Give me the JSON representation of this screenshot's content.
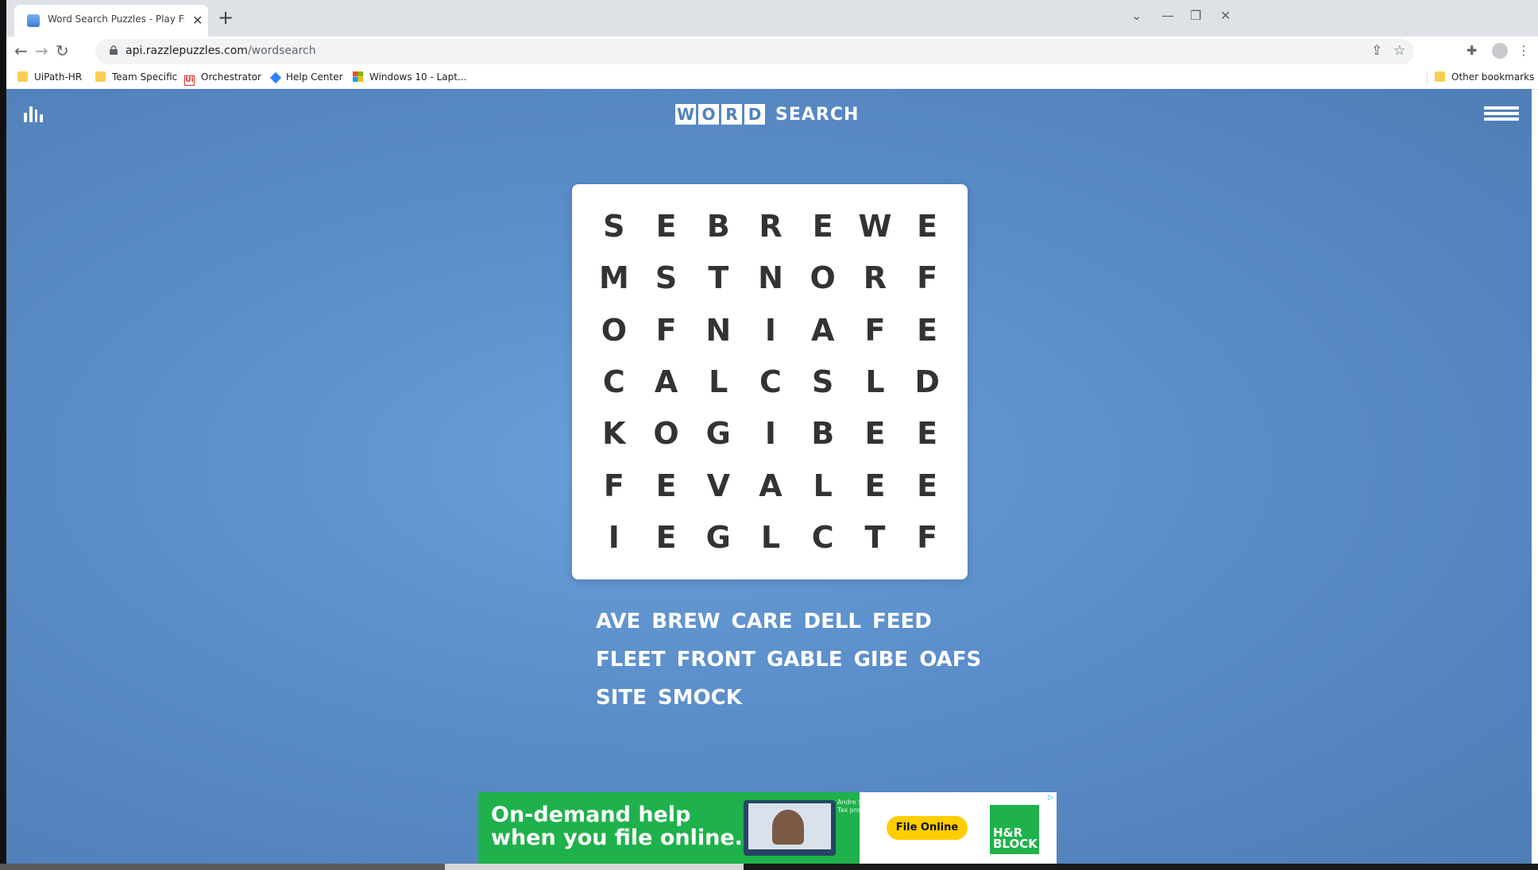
{
  "browser": {
    "tab_title": "Word Search Puzzles - Play Free Online",
    "url_host": "api.razzlepuzzles.com",
    "url_path": "/wordsearch",
    "bookmarks": [
      "UiPath-HR",
      "Team Specific",
      "Orchestrator",
      "Help Center",
      "Windows 10 - Lapt..."
    ],
    "other_bookmarks": "Other bookmarks"
  },
  "header": {
    "logo_letters": [
      "W",
      "O",
      "R",
      "D"
    ],
    "logo_word": "SEARCH"
  },
  "grid": [
    [
      "S",
      "E",
      "B",
      "R",
      "E",
      "W",
      "E"
    ],
    [
      "M",
      "S",
      "T",
      "N",
      "O",
      "R",
      "F"
    ],
    [
      "O",
      "F",
      "N",
      "I",
      "A",
      "F",
      "E"
    ],
    [
      "C",
      "A",
      "L",
      "C",
      "S",
      "L",
      "D"
    ],
    [
      "K",
      "O",
      "G",
      "I",
      "B",
      "E",
      "E"
    ],
    [
      "F",
      "E",
      "V",
      "A",
      "L",
      "E",
      "E"
    ],
    [
      "I",
      "E",
      "G",
      "L",
      "C",
      "T",
      "F"
    ]
  ],
  "word_rows": [
    [
      "AVE",
      "BREW",
      "CARE",
      "DELL",
      "FEED"
    ],
    [
      "FLEET",
      "FRONT",
      "GABLE",
      "GIBE",
      "OAFS"
    ],
    [
      "SITE",
      "SMOCK"
    ]
  ],
  "ad": {
    "headline": "On-demand help\nwhen you file online.",
    "person_caption": "Andre S.\nTax pro",
    "cta": "File Online",
    "brand": "H&R\nBLOCK"
  },
  "colors": {
    "page_bg": "#5a8dc9",
    "ad_green": "#1fb14b",
    "cta_yellow": "#ffcd00"
  }
}
